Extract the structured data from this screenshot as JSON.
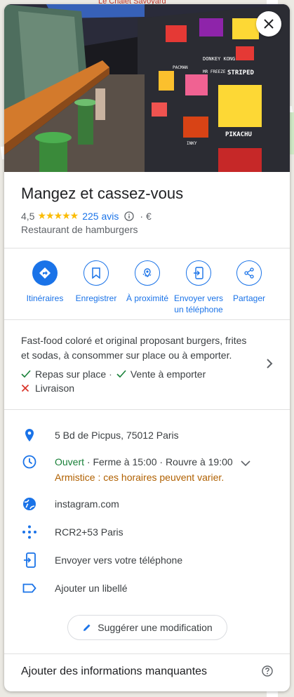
{
  "place": {
    "name": "Mangez et cassez-vous",
    "rating": "4,5",
    "stars": "★★★★★",
    "reviews": "225 avis",
    "price": "· €",
    "category": "Restaurant de hamburgers"
  },
  "hero_signs": [
    "DONKEY KONG",
    "PACMAN",
    "MR FREEZE",
    "STRIPED",
    "PIKACHU",
    "INKY"
  ],
  "map_labels": [
    "Le Chalet Savoyard"
  ],
  "actions": [
    {
      "label": "Itinéraires",
      "icon": "directions-icon"
    },
    {
      "label": "Enregistrer",
      "icon": "bookmark-icon"
    },
    {
      "label": "À proximité",
      "icon": "nearby-icon"
    },
    {
      "label": "Envoyer vers un téléphone",
      "icon": "send-to-phone-icon"
    },
    {
      "label": "Partager",
      "icon": "share-icon"
    }
  ],
  "description": "Fast-food coloré et original proposant burgers, frites et sodas, à consommer sur place ou à emporter.",
  "features": {
    "dine_in": "Repas sur place",
    "separator": "·",
    "takeaway": "Vente à emporter",
    "delivery": "Livraison"
  },
  "info": {
    "address": "5 Bd de Picpus, 75012 Paris",
    "hours_status": "Ouvert",
    "hours_detail": "· Ferme à 15:00 · Rouvre à 19:00",
    "hours_warning": "Armistice : ces horaires peuvent varier.",
    "website": "instagram.com",
    "plus_code": "RCR2+53 Paris",
    "send_phone": "Envoyer vers votre téléphone",
    "label": "Ajouter un libellé"
  },
  "suggest_label": "Suggérer une modification",
  "missing_info": "Ajouter des informations manquantes",
  "colors": {
    "accent": "#1a73e8",
    "open": "#188038",
    "warning": "#b06000",
    "star": "#fbbc04",
    "error": "#d93025"
  }
}
